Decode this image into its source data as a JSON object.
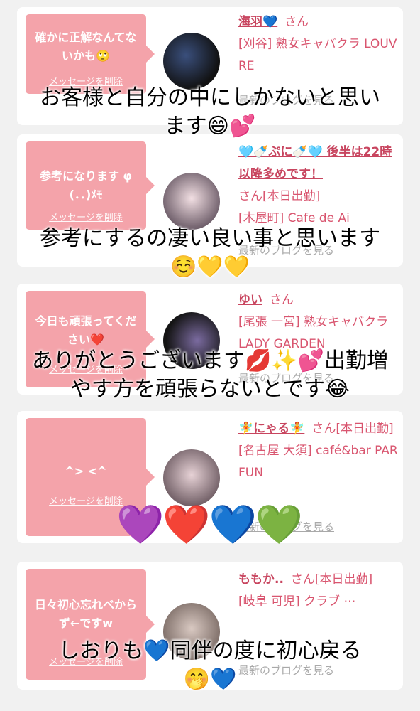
{
  "cards": [
    {
      "message": "確かに正解なんてないかも🙄",
      "delete_label": "メッセージを削除",
      "name": "海羽💙",
      "suffix": "さん",
      "shop": "[刈谷] 熟女キャバクラ LOUVRE",
      "blog_label": "最新のブログを見る",
      "caption_lines": [
        "お客様と自分の中にしかないと思い",
        "ます😄💕"
      ]
    },
    {
      "message": "参考になります φ(．．)ﾒﾓ",
      "delete_label": "メッセージを削除",
      "name": "🩵🍼ぷに🍼🩵 後半は22時以降多めです！",
      "suffix": "さん[本日出勤]",
      "shop": "[木屋町] Cafe de Ai",
      "blog_label": "最新のブログを見る",
      "caption_lines": [
        "参考にするの凄い良い事と思います",
        "☺️💛💛"
      ]
    },
    {
      "message": "今日も頑張ってください❤️",
      "delete_label": "メッセージを削除",
      "name": "ゆい",
      "suffix": "さん",
      "shop": "[尾張 一宮] 熟女キャバクラ LADY GARDEN",
      "blog_label": "最新のブログを見る",
      "caption_lines": [
        "ありがとうございます💋✨💕出勤増",
        "やす方を頑張らないとです😂"
      ]
    },
    {
      "message": "^> <^",
      "delete_label": "メッセージを削除",
      "name": "🧚にゃる🧚",
      "suffix": "さん[本日出勤]",
      "shop": "[名古屋 大須] café&bar PARFUN",
      "blog_label": "最新のブログを見る",
      "caption_lines": [
        "💜❤️💙💚"
      ]
    },
    {
      "message": "日々初心忘れべからず←ですw",
      "delete_label": "メッセージを削除",
      "name": "ももか..",
      "suffix": "さん[本日出勤]",
      "shop": "[岐阜 可児] クラブ ⋯",
      "blog_label": "最新のブログを見る",
      "caption_lines": [
        "しおりも💙同伴の度に初心戻る",
        "🤭💙"
      ]
    }
  ],
  "colors": {
    "accent": "#f4a3aa",
    "name": "#c8455f",
    "shop": "#d9556f",
    "link_gray": "#a9a9a9",
    "background": "#f1f1f1"
  },
  "icons": {
    "bubble": "speech-bubble-icon",
    "avatar": "profile-avatar"
  }
}
